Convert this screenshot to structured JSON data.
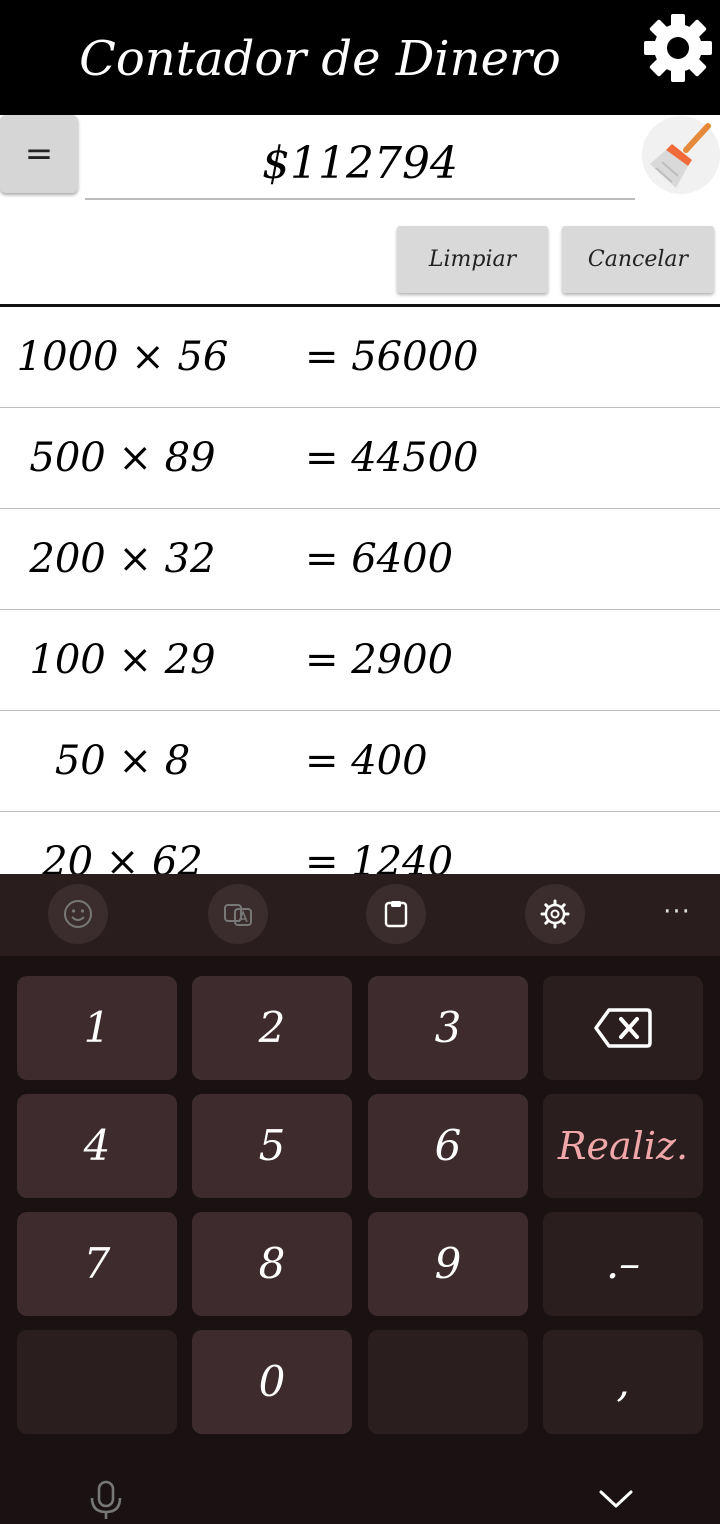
{
  "app": {
    "title": "Contador de Dinero"
  },
  "input": {
    "equals_label": "=",
    "total": "$112794"
  },
  "actions": {
    "clear_label": "Limpiar",
    "cancel_label": "Cancelar"
  },
  "rows": [
    {
      "expr": "1000 × 56",
      "result": "= 56000"
    },
    {
      "expr": "500 × 89",
      "result": "= 44500"
    },
    {
      "expr": "200 × 32",
      "result": "= 6400"
    },
    {
      "expr": "100 × 29",
      "result": "= 2900"
    },
    {
      "expr": "50 × 8",
      "result": "= 400"
    },
    {
      "expr": "20 × 62",
      "result": "= 1240"
    }
  ],
  "keyboard": {
    "keys": {
      "k1": "1",
      "k2": "2",
      "k3": "3",
      "k4": "4",
      "k5": "5",
      "k6": "6",
      "k7": "7",
      "k8": "8",
      "k9": "9",
      "k0": "0",
      "done": "Realiz.",
      "dot_dash": ".–",
      "comma": ","
    },
    "more": "···"
  },
  "colors": {
    "header_bg": "#000000",
    "keyboard_bg": "#1a1212",
    "key_bg": "#3d2b2d",
    "done_text": "#f0a7a9"
  },
  "icons": [
    "gear-icon",
    "broom-icon",
    "emoji-icon",
    "translate-icon",
    "clipboard-icon",
    "keyboard-settings-icon",
    "backspace-icon",
    "mic-icon",
    "chevron-down-icon"
  ]
}
